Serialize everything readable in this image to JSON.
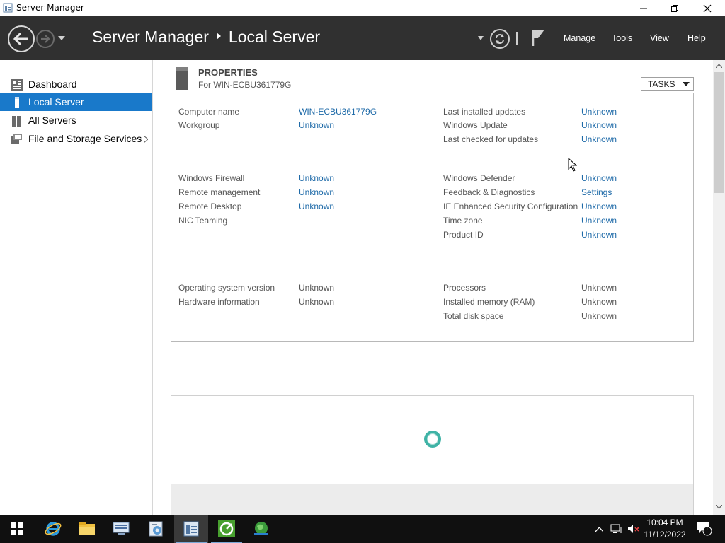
{
  "window": {
    "title": "Server Manager"
  },
  "header": {
    "breadcrumb_root": "Server Manager",
    "breadcrumb_current": "Local Server",
    "menus": [
      "Manage",
      "Tools",
      "View",
      "Help"
    ]
  },
  "sidebar": {
    "items": [
      {
        "label": "Dashboard",
        "icon": "dashboard-icon",
        "active": false
      },
      {
        "label": "Local Server",
        "icon": "local-server-icon",
        "active": true
      },
      {
        "label": "All Servers",
        "icon": "all-servers-icon",
        "active": false
      },
      {
        "label": "File and Storage Services",
        "icon": "storage-icon",
        "active": false,
        "has_submenu": true
      }
    ]
  },
  "properties": {
    "title": "PROPERTIES",
    "subtitle": "For WIN-ECBU361779G",
    "tasks_label": "TASKS",
    "left_group1": [
      {
        "label": "Computer name",
        "value": "WIN-ECBU361779G",
        "link": true
      },
      {
        "label": "Workgroup",
        "value": "Unknown",
        "link": true
      }
    ],
    "right_group1": [
      {
        "label": "Last installed updates",
        "value": "Unknown",
        "link": true
      },
      {
        "label": "Windows Update",
        "value": "Unknown",
        "link": true
      },
      {
        "label": "Last checked for updates",
        "value": "Unknown",
        "link": true
      }
    ],
    "left_group2": [
      {
        "label": "Windows Firewall",
        "value": "Unknown",
        "link": true
      },
      {
        "label": "Remote management",
        "value": "Unknown",
        "link": true
      },
      {
        "label": "Remote Desktop",
        "value": "Unknown",
        "link": true
      },
      {
        "label": "NIC Teaming",
        "value": "",
        "link": true
      }
    ],
    "right_group2": [
      {
        "label": "Windows Defender",
        "value": "Unknown",
        "link": true
      },
      {
        "label": "Feedback & Diagnostics",
        "value": "Settings",
        "link": true
      },
      {
        "label": "IE Enhanced Security Configuration",
        "value": "Unknown",
        "link": true
      },
      {
        "label": "Time zone",
        "value": "Unknown",
        "link": true
      },
      {
        "label": "Product ID",
        "value": "Unknown",
        "link": true
      }
    ],
    "left_group3": [
      {
        "label": "Operating system version",
        "value": "Unknown",
        "link": false
      },
      {
        "label": "Hardware information",
        "value": "Unknown",
        "link": false
      }
    ],
    "right_group3": [
      {
        "label": "Processors",
        "value": "Unknown",
        "link": false
      },
      {
        "label": "Installed memory (RAM)",
        "value": "Unknown",
        "link": false
      },
      {
        "label": "Total disk space",
        "value": "Unknown",
        "link": false
      }
    ]
  },
  "taskbar": {
    "apps": [
      "start-icon",
      "internet-explorer-icon",
      "file-explorer-icon",
      "network-tool-icon",
      "control-panel-icon",
      "server-manager-icon",
      "green-app-icon",
      "network-globe-icon"
    ],
    "clock_time": "10:04 PM",
    "clock_date": "11/12/2022",
    "notification_count": "1"
  },
  "colors": {
    "header_bg": "#303030",
    "sidebar_active": "#1979ca",
    "link": "#1e6aa8",
    "taskbar_bg": "#101010"
  }
}
